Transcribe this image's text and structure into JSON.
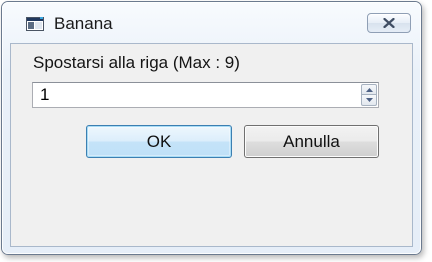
{
  "window": {
    "title": "Banana",
    "icon": "application-window-icon",
    "close_icon": "close-icon"
  },
  "dialog": {
    "prompt": "Spostarsi alla riga (Max :  9)",
    "line_number": {
      "value": "1",
      "up_icon": "spin-up-icon",
      "down_icon": "spin-down-icon"
    },
    "ok_label": "OK",
    "cancel_label": "Annulla"
  },
  "colors": {
    "accent": "#3c7fb1",
    "window_frame": "#eaf1f9",
    "client_background": "#f0f0f0"
  }
}
